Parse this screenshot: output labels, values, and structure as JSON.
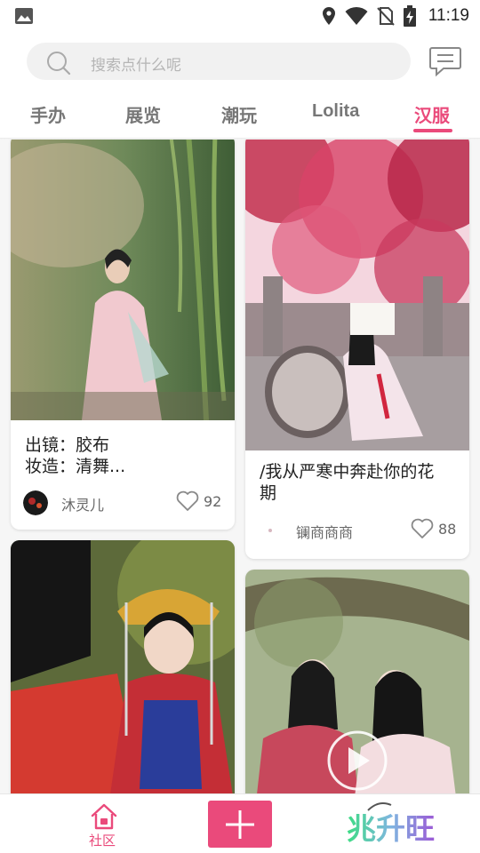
{
  "status_bar": {
    "time": "11:19",
    "icons": [
      "gallery-notification-icon",
      "location-icon",
      "wifi-icon",
      "no-sim-icon",
      "battery-charging-icon"
    ]
  },
  "search": {
    "placeholder": "搜索点什么呢"
  },
  "tabs": [
    {
      "label": "手办",
      "active": false
    },
    {
      "label": "展览",
      "active": false
    },
    {
      "label": "潮玩",
      "active": false
    },
    {
      "label": "Lolita",
      "active": false
    },
    {
      "label": "汉服",
      "active": true
    }
  ],
  "posts": [
    {
      "title_line1": "出镜：胶布",
      "title_line2": "妆造：清舞...",
      "author": "沐灵儿",
      "likes": "92"
    },
    {
      "title_line1": "/我从严寒中奔赴你的花",
      "title_line2": "期",
      "author": "镧商商商",
      "likes": "88"
    },
    {
      "title_line1": "",
      "title_line2": "",
      "author": "",
      "likes": ""
    },
    {
      "title_line1": "",
      "title_line2": "",
      "author": "",
      "likes": ""
    }
  ],
  "bottom_nav": {
    "community_label": "社区",
    "add_icon": "plus-icon",
    "brand_text": "兆升旺"
  },
  "colors": {
    "accent": "#ea4a7b",
    "search_bg": "#f1f1f1",
    "brand_gradient": [
      "#3ddc84",
      "#9b59d6"
    ]
  }
}
